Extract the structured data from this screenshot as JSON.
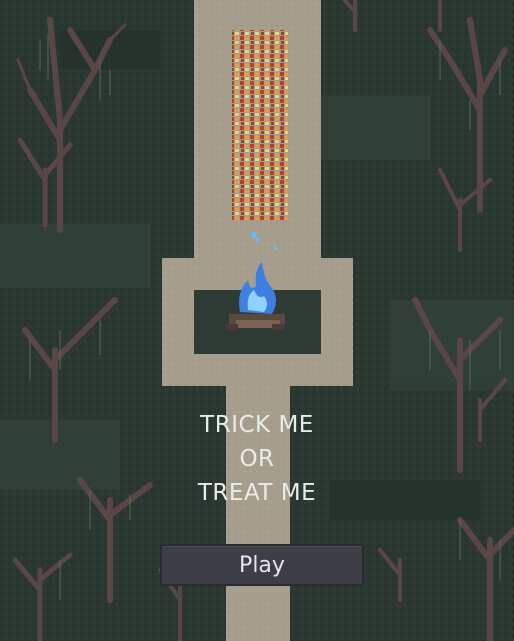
{
  "title": {
    "line1": "TRICK ME",
    "line2": "OR",
    "line3": "TREAT ME"
  },
  "play_button": {
    "label": "Play"
  },
  "colors": {
    "grass_dark": "#26332d",
    "grass_mid": "#2f3d36",
    "grass_light": "#3a4a42",
    "path": "#a69e8d",
    "flame": "#6fb4ff",
    "tree": "#5b4646"
  },
  "icons": [
    "campfire-blue-flame",
    "food-treat-icons",
    "dead-tree"
  ]
}
